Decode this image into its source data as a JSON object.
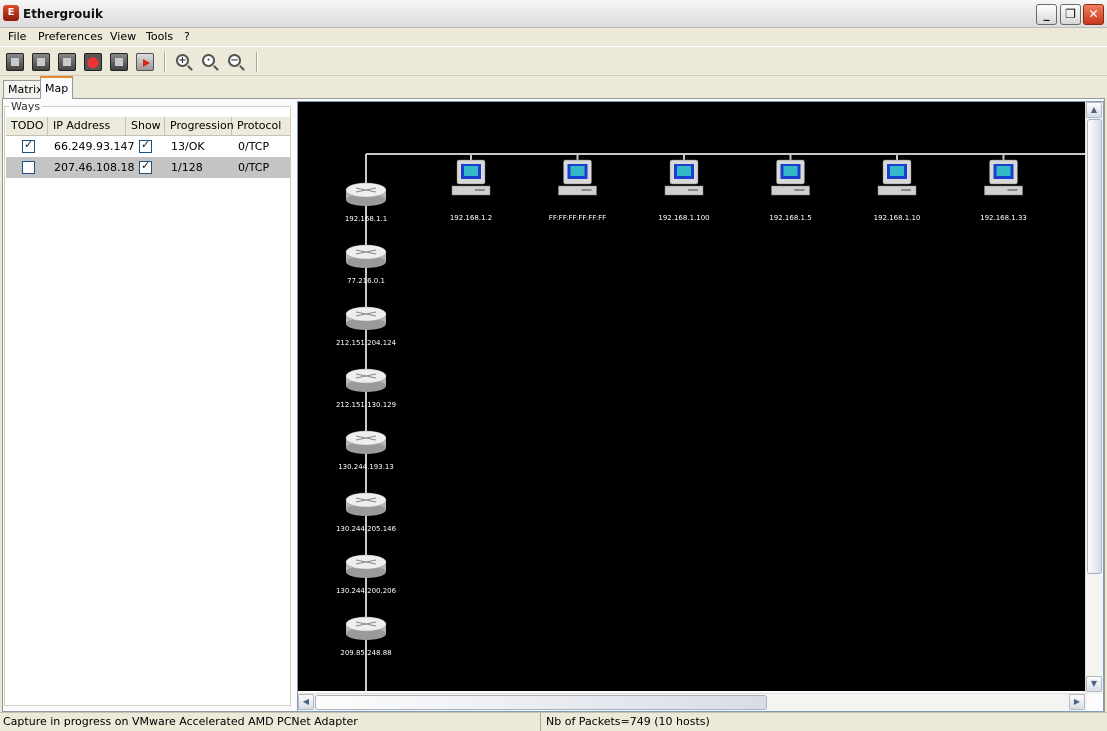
{
  "window": {
    "title": "Ethergrouik"
  },
  "menu": [
    "File",
    "Preferences",
    "View",
    "Tools",
    "?"
  ],
  "toolbar": {
    "buttons": [
      "capture-start-icon",
      "capture-pause-icon",
      "capture-stop-icon",
      "record-icon",
      "save-capture-icon",
      "exit-icon",
      "zoom-in-icon",
      "zoom-fit-icon",
      "zoom-out-icon"
    ]
  },
  "tabs": [
    {
      "label": "Matrix"
    },
    {
      "label": "Map"
    }
  ],
  "ways": {
    "title": "Ways",
    "columns": [
      "TODO",
      "IP Address",
      "Show",
      "Progression",
      "Protocol"
    ],
    "rows": [
      {
        "todo": true,
        "ip": "66.249.93.147",
        "show": true,
        "progression": "13/OK",
        "protocol": "0/TCP"
      },
      {
        "todo": false,
        "ip": "207.46.108.18",
        "show": true,
        "progression": "1/128",
        "protocol": "0/TCP"
      }
    ]
  },
  "map": {
    "routers": [
      "192.168.1.1",
      "77.216.0.1",
      "212.151.204.124",
      "212.151.130.129",
      "130.244.193.13",
      "130.244.205.146",
      "130.244.200.206",
      "209.85.248.88"
    ],
    "hosts": [
      "192.168.1.2",
      "FF:FF:FF:FF:FF:FF",
      "192.168.1.100",
      "192.168.1.5",
      "192.168.1.10",
      "192.168.1.33"
    ],
    "background_color": "#000000",
    "link_color": "#c8c8c8",
    "host_screen_color": "#35b9c9"
  },
  "status": {
    "capture": "Capture in progress on  VMware Accelerated AMD PCNet Adapter",
    "packets": "Nb of Packets=749 (10 hosts)"
  }
}
